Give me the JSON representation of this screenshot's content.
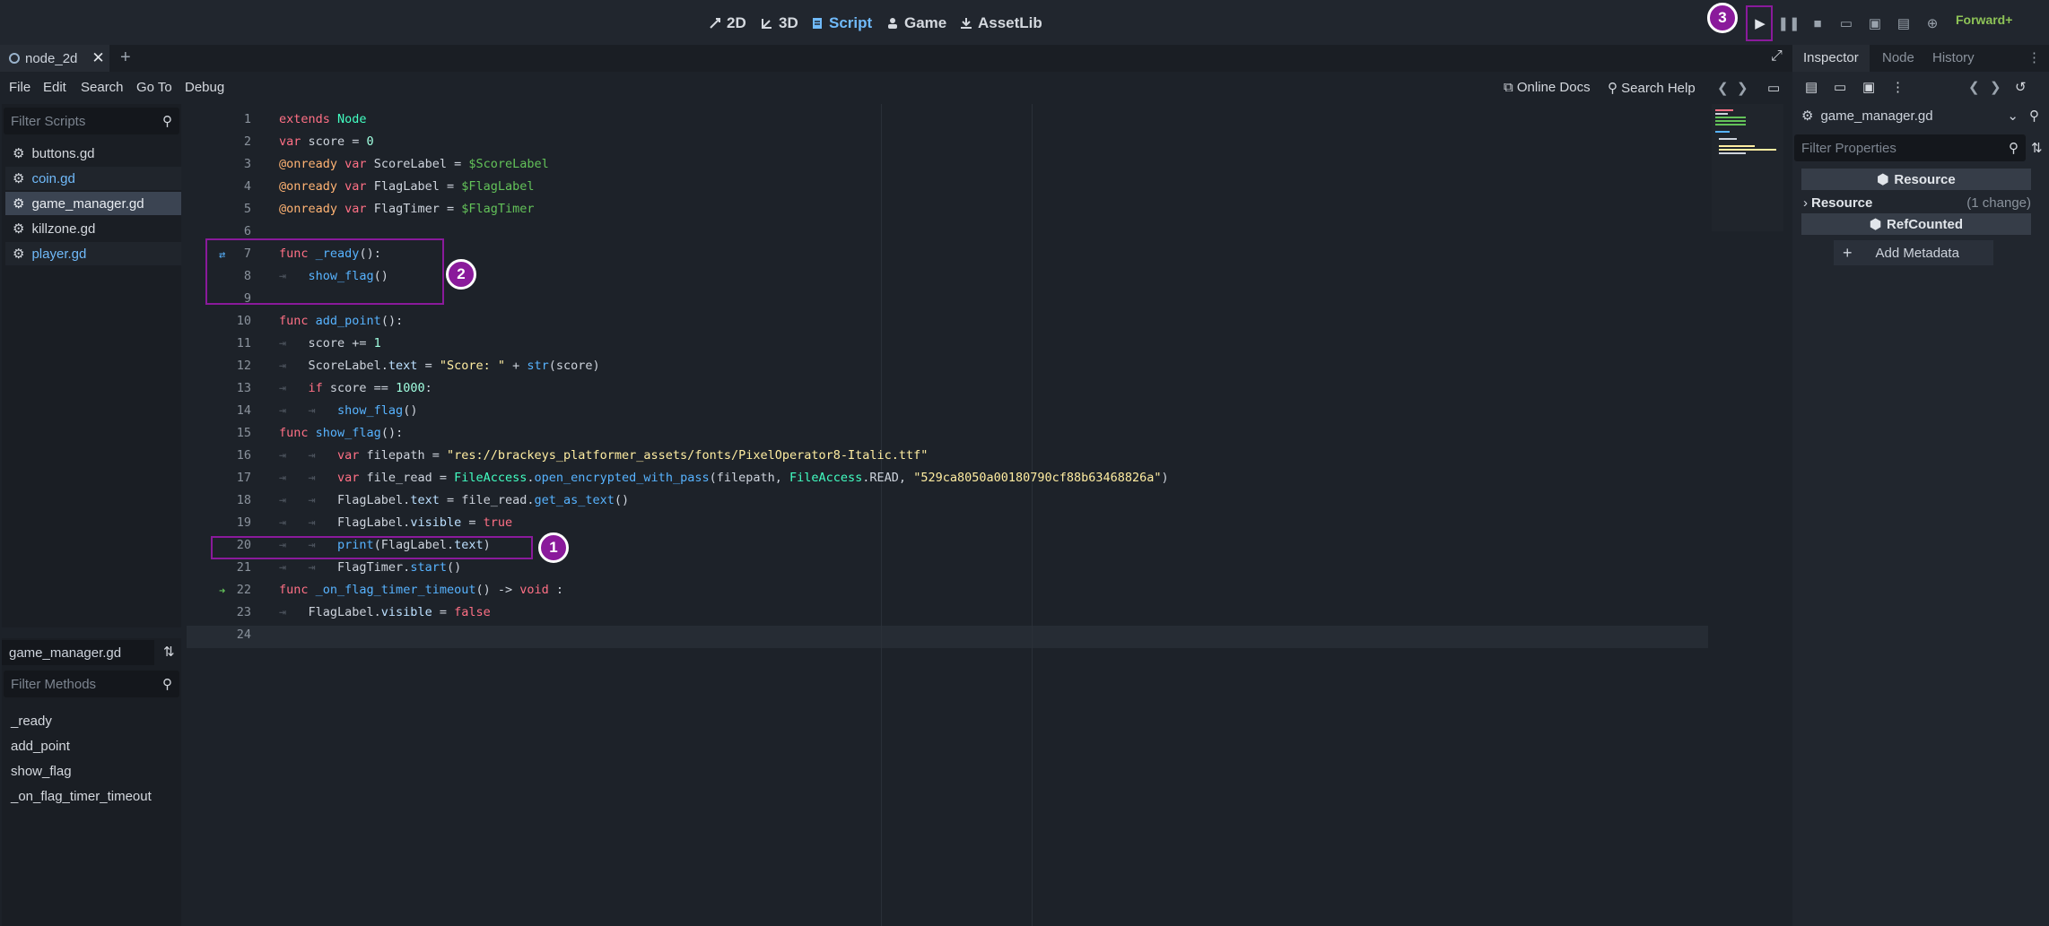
{
  "workspaces": [
    {
      "label": "2D",
      "icon": "2d-icon"
    },
    {
      "label": "3D",
      "icon": "3d-icon"
    },
    {
      "label": "Script",
      "icon": "script-icon"
    },
    {
      "label": "Game",
      "icon": "game-icon"
    },
    {
      "label": "AssetLib",
      "icon": "assetlib-icon"
    }
  ],
  "renderer": "Forward+",
  "scene_tab": "node_2d",
  "menu": [
    "File",
    "Edit",
    "Search",
    "Go To",
    "Debug"
  ],
  "online_docs": "Online Docs",
  "search_help": "Search Help",
  "filter_scripts": "Filter Scripts",
  "scripts": [
    "buttons.gd",
    "coin.gd",
    "game_manager.gd",
    "killzone.gd",
    "player.gd"
  ],
  "current_script": "game_manager.gd",
  "filter_methods": "Filter Methods",
  "methods": [
    "_ready",
    "add_point",
    "show_flag",
    "_on_flag_timer_timeout"
  ],
  "line_numbers": [
    "1",
    "2",
    "3",
    "4",
    "5",
    "6",
    "7",
    "8",
    "9",
    "10",
    "11",
    "12",
    "13",
    "14",
    "15",
    "16",
    "17",
    "18",
    "19",
    "20",
    "21",
    "22",
    "23",
    "24"
  ],
  "inspector": {
    "tabs": [
      "Inspector",
      "Node",
      "History"
    ],
    "resource_name": "game_manager.gd",
    "filter_properties": "Filter Properties",
    "section_resource": "Resource",
    "resource_row": "Resource",
    "change_note": "(1 change)",
    "section_refcounted": "RefCounted",
    "add_metadata": "Add Metadata"
  },
  "annotations": [
    "1",
    "2",
    "3"
  ],
  "colors": {
    "accent": "#70bafa",
    "annotation": "#8a1a9b",
    "renderer": "#8ec357"
  }
}
